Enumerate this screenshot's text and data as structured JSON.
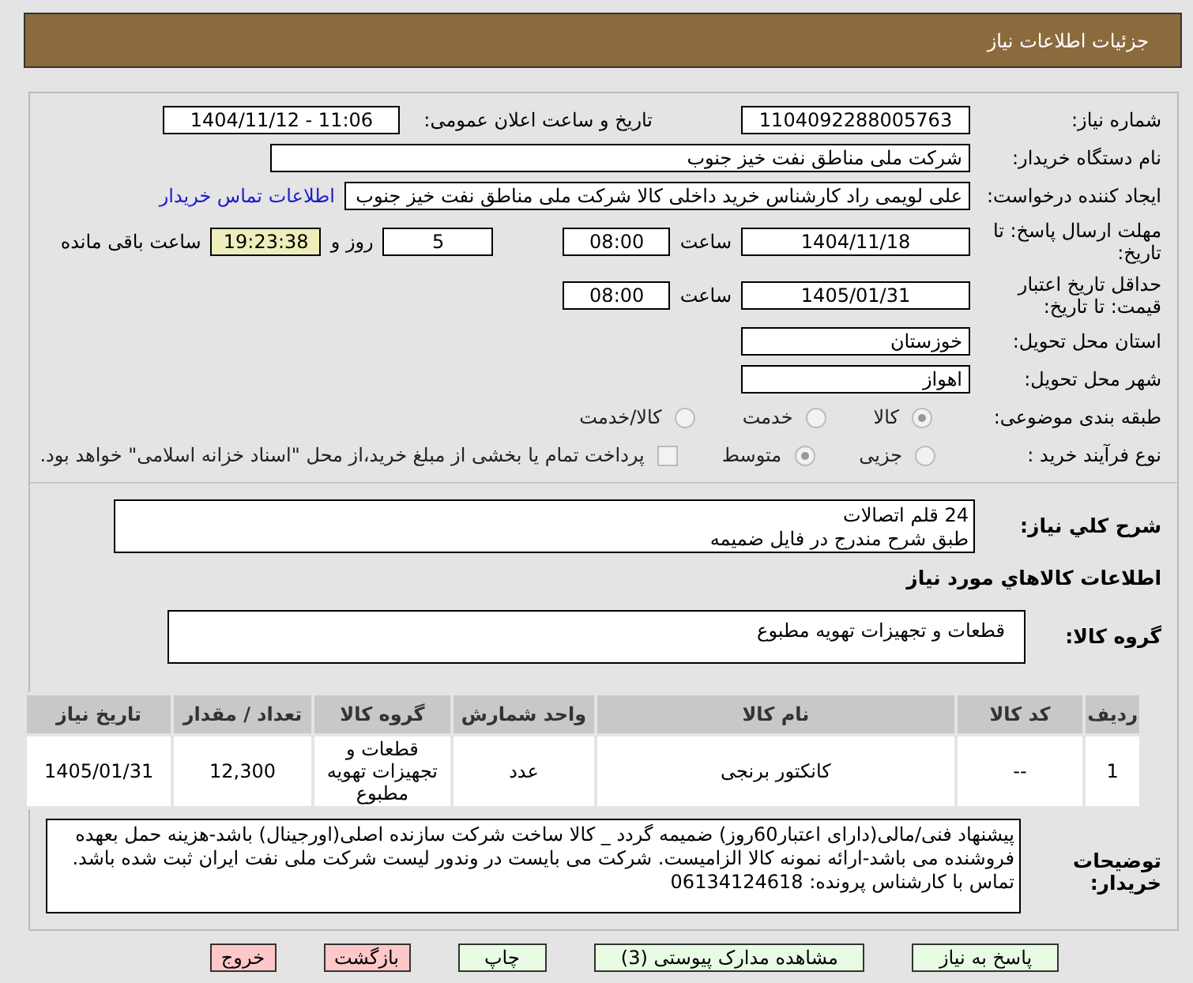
{
  "header": {
    "title": "جزئیات اطلاعات نیاز"
  },
  "fields": {
    "need_number": {
      "label": "شماره نیاز:",
      "value": "1104092288005763"
    },
    "announce": {
      "label": "تاریخ و ساعت اعلان عمومی:",
      "value": "1404/11/12 - 11:06"
    },
    "buyer": {
      "label": "نام دستگاه خریدار:",
      "value": "شرکت ملی مناطق نفت خیز جنوب"
    },
    "creator": {
      "label": "ایجاد کننده درخواست:",
      "value": "علی  لویمی راد  کارشناس خرید داخلی کالا شرکت ملی مناطق نفت خیز جنوب",
      "link": "اطلاعات تماس خریدار"
    },
    "deadline": {
      "label": "مهلت ارسال پاسخ: تا تاریخ:",
      "date": "1404/11/18",
      "time_label": "ساعت",
      "time": "08:00",
      "days": "5",
      "days_label": "روز و",
      "remaining": "19:23:38",
      "remaining_label": "ساعت باقی مانده"
    },
    "validity": {
      "label": "حداقل تاریخ اعتبار قیمت: تا تاریخ:",
      "date": "1405/01/31",
      "time_label": "ساعت",
      "time": "08:00"
    },
    "province": {
      "label": "استان محل تحویل:",
      "value": "خوزستان"
    },
    "city": {
      "label": "شهر محل تحویل:",
      "value": "اهواز"
    }
  },
  "category": {
    "label": "طبقه بندی موضوعی:",
    "options": [
      {
        "label": "کالا",
        "selected": true
      },
      {
        "label": "خدمت",
        "selected": false
      },
      {
        "label": "کالا/خدمت",
        "selected": false
      }
    ]
  },
  "process": {
    "label": "نوع فرآیند خرید :",
    "options": [
      {
        "label": "جزیی",
        "selected": false
      },
      {
        "label": "متوسط",
        "selected": true
      }
    ],
    "payment": {
      "label": "پرداخت تمام یا بخشی از مبلغ خرید،از محل \"اسناد خزانه اسلامی\" خواهد بود.",
      "checked": false
    }
  },
  "summary": {
    "label": "شرح کلي نیاز:",
    "value": "24 قلم اتصالات\nطبق شرح مندرج در فایل ضمیمه"
  },
  "goods_title": "اطلاعات کالاهاي مورد نیاز",
  "goods_group": {
    "label": "گروه کالا:",
    "value": "قطعات و تجهیزات تهویه مطبوع"
  },
  "table": {
    "columns": [
      "ردیف",
      "کد کالا",
      "نام کالا",
      "واحد شمارش",
      "گروه کالا",
      "تعداد / مقدار",
      "تاریخ نیاز"
    ],
    "rows": [
      [
        "1",
        "--",
        "کانکتور برنجی",
        "عدد",
        "قطعات و تجهیزات تهویه مطبوع",
        "12,300",
        "1405/01/31"
      ]
    ]
  },
  "notes": {
    "label": "توضیحات خریدار:",
    "value": "پیشنهاد فنی/مالی(دارای اعتبار60روز) ضمیمه گردد _ کالا ساخت شرکت سازنده اصلی(اورجینال) باشد-هزینه حمل بعهده فروشنده می باشد-ارائه نمونه کالا الزامیست. شرکت می بایست در وندور لیست شرکت ملی نفت ایران ثبت شده باشد.\nتماس با کارشناس پرونده: 06134124618"
  },
  "buttons": [
    {
      "label": "پاسخ به نیاز",
      "kind": "primary"
    },
    {
      "label": "مشاهده مدارک پیوستی (3)",
      "kind": "primary"
    },
    {
      "label": "چاپ",
      "kind": "primary"
    },
    {
      "label": "بازگشت",
      "kind": "danger"
    },
    {
      "label": "خروج",
      "kind": "danger"
    }
  ]
}
